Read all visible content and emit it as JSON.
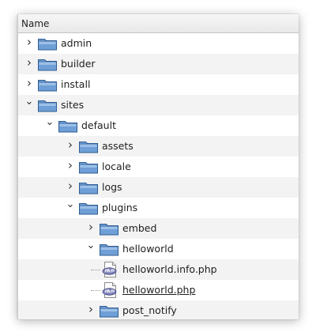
{
  "header": {
    "name_label": "Name"
  },
  "tree": [
    {
      "label": "admin",
      "kind": "folder",
      "depth": 0,
      "expanded": false
    },
    {
      "label": "builder",
      "kind": "folder",
      "depth": 0,
      "expanded": false
    },
    {
      "label": "install",
      "kind": "folder",
      "depth": 0,
      "expanded": false
    },
    {
      "label": "sites",
      "kind": "folder",
      "depth": 0,
      "expanded": true
    },
    {
      "label": "default",
      "kind": "folder",
      "depth": 1,
      "expanded": true
    },
    {
      "label": "assets",
      "kind": "folder",
      "depth": 2,
      "expanded": false
    },
    {
      "label": "locale",
      "kind": "folder",
      "depth": 2,
      "expanded": false
    },
    {
      "label": "logs",
      "kind": "folder",
      "depth": 2,
      "expanded": false
    },
    {
      "label": "plugins",
      "kind": "folder",
      "depth": 2,
      "expanded": true
    },
    {
      "label": "embed",
      "kind": "folder",
      "depth": 3,
      "expanded": false
    },
    {
      "label": "helloworld",
      "kind": "folder",
      "depth": 3,
      "expanded": true
    },
    {
      "label": "helloworld.info.php",
      "kind": "php",
      "depth": 4,
      "underline": false
    },
    {
      "label": "helloworld.php",
      "kind": "php",
      "depth": 4,
      "underline": true
    },
    {
      "label": "post_notify",
      "kind": "folder",
      "depth": 3,
      "expanded": false
    }
  ],
  "icons": {
    "folder": "folder-icon",
    "php": "php-file-icon",
    "collapsed": "chevron-right-icon",
    "expanded": "chevron-down-icon"
  },
  "colors": {
    "folder_fill": "#6f9fd6",
    "folder_top": "#9cc0e8",
    "folder_stroke": "#2f5d93",
    "row_alt": "#f3f3f3"
  }
}
